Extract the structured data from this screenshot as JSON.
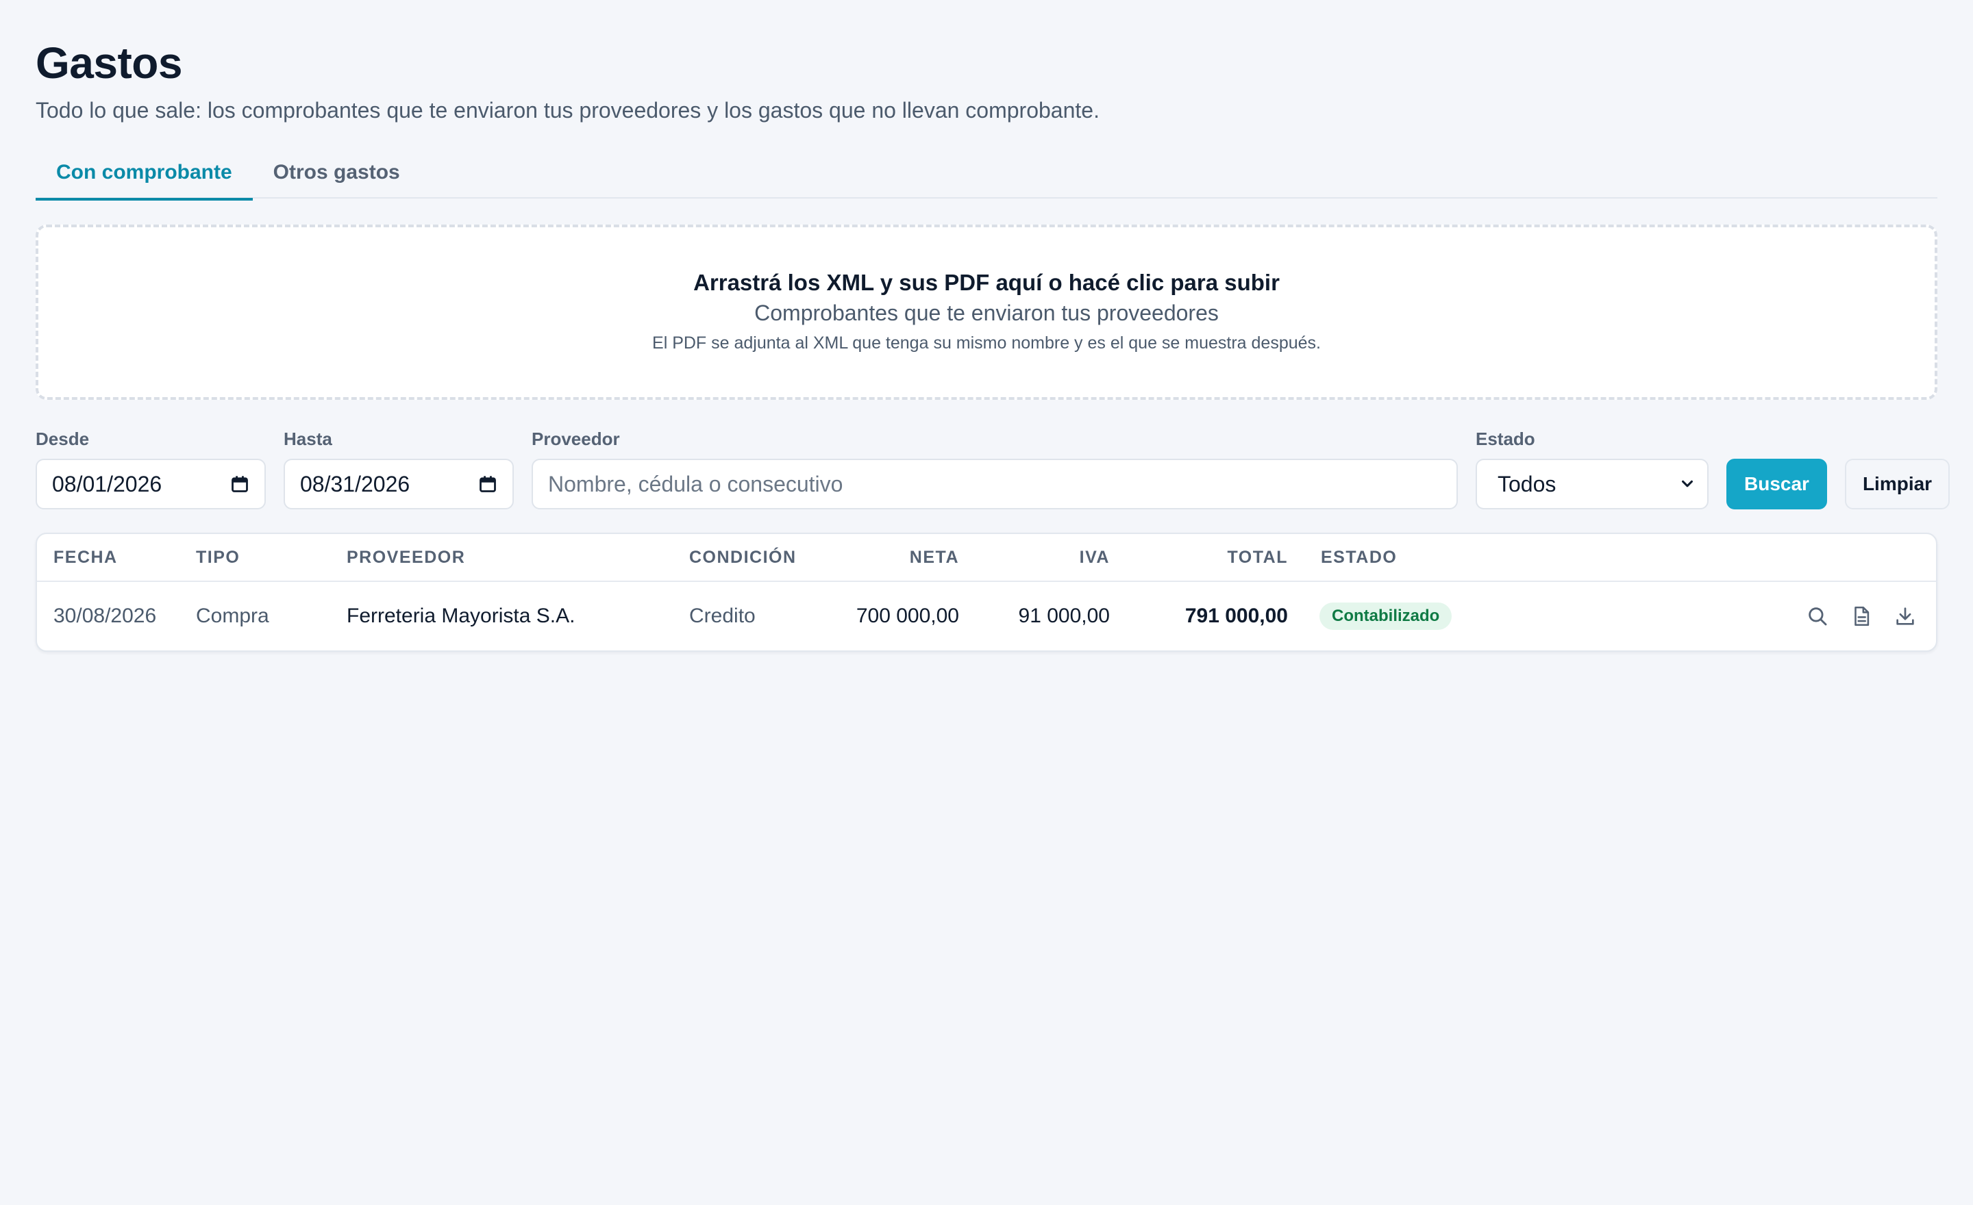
{
  "page": {
    "title": "Gastos",
    "subtitle": "Todo lo que sale: los comprobantes que te enviaron tus proveedores y los gastos que no llevan comprobante."
  },
  "tabs": [
    {
      "label": "Con comprobante",
      "active": true
    },
    {
      "label": "Otros gastos",
      "active": false
    }
  ],
  "dropzone": {
    "title": "Arrastrá los XML y sus PDF aquí o hacé clic para subir",
    "subtitle": "Comprobantes que te enviaron tus proveedores",
    "note": "El PDF se adjunta al XML que tenga su mismo nombre y es el que se muestra después."
  },
  "filters": {
    "desde_label": "Desde",
    "desde_value": "08/01/2026",
    "hasta_label": "Hasta",
    "hasta_value": "08/31/2026",
    "proveedor_label": "Proveedor",
    "proveedor_placeholder": "Nombre, cédula o consecutivo",
    "estado_label": "Estado",
    "estado_value": "Todos",
    "buscar_label": "Buscar",
    "limpiar_label": "Limpiar"
  },
  "table": {
    "columns": [
      "FECHA",
      "TIPO",
      "PROVEEDOR",
      "CONDICIÓN",
      "NETA",
      "IVA",
      "TOTAL",
      "ESTADO"
    ],
    "rows": [
      {
        "fecha": "30/08/2026",
        "tipo": "Compra",
        "proveedor": "Ferreteria Mayorista S.A.",
        "condicion": "Credito",
        "neta": "700 000,00",
        "iva": "91 000,00",
        "total": "791 000,00",
        "estado": "Contabilizado"
      }
    ]
  },
  "icons": {
    "row_actions": [
      "search-icon",
      "document-icon",
      "download-icon"
    ],
    "date_picker": "calendar-icon",
    "select": "chevron-down-icon"
  },
  "colors": {
    "accent": "#0a8aa8",
    "primary_button": "#15a6c8",
    "badge_bg": "#e4f6ec",
    "badge_text": "#0f7a44",
    "background": "#f4f6fa"
  }
}
